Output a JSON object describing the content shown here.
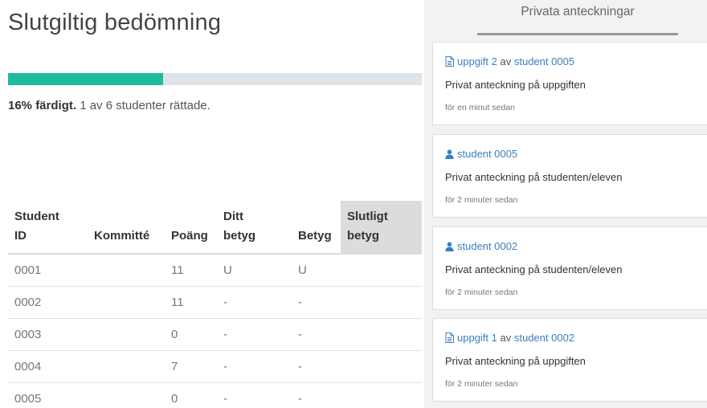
{
  "page": {
    "title": "Slutgiltig bedömning"
  },
  "progress": {
    "percent": 16,
    "fill_fraction": 0.375,
    "strong_text": "16% färdigt.",
    "detail_text": "1 av 6 studenter rättade.",
    "colors": {
      "fill": "#1fbc9c",
      "track": "#dfe4e8"
    }
  },
  "table": {
    "headers": {
      "student_id_line1": "Student",
      "student_id_line2": "ID",
      "kommitte": "Kommitté",
      "poang": "Poäng",
      "ditt_betyg_line1": "Ditt",
      "ditt_betyg_line2": "betyg",
      "betyg": "Betyg",
      "slutligt_betyg_line1": "Slutligt",
      "slutligt_betyg_line2": "betyg"
    },
    "rows": [
      {
        "id": "0001",
        "kommitte": "",
        "poang": "11",
        "ditt": "U",
        "betyg": "U",
        "slutligt": ""
      },
      {
        "id": "0002",
        "kommitte": "",
        "poang": "11",
        "ditt": "-",
        "betyg": "-",
        "slutligt": ""
      },
      {
        "id": "0003",
        "kommitte": "",
        "poang": "0",
        "ditt": "-",
        "betyg": "-",
        "slutligt": ""
      },
      {
        "id": "0004",
        "kommitte": "",
        "poang": "7",
        "ditt": "-",
        "betyg": "-",
        "slutligt": ""
      },
      {
        "id": "0005",
        "kommitte": "",
        "poang": "0",
        "ditt": "-",
        "betyg": "-",
        "slutligt": ""
      }
    ]
  },
  "sidebar": {
    "title": "Privata anteckningar",
    "notes": [
      {
        "icon": "file-icon",
        "link1": "uppgift 2",
        "sep": "av",
        "link2": "student 0005",
        "body": "Privat anteckning på uppgiften",
        "time": "för en minut sedan"
      },
      {
        "icon": "user-icon",
        "link1": "student 0005",
        "sep": "",
        "link2": "",
        "body": "Privat anteckning på studenten/eleven",
        "time": "för 2 minuter sedan"
      },
      {
        "icon": "user-icon",
        "link1": "student 0002",
        "sep": "",
        "link2": "",
        "body": "Privat anteckning på studenten/eleven",
        "time": "för 2 minuter sedan"
      },
      {
        "icon": "file-icon",
        "link1": "uppgift 1",
        "sep": "av",
        "link2": "student 0002",
        "body": "Privat anteckning på uppgiften",
        "time": "för 2 minuter sedan"
      }
    ],
    "link_color": "#3c7fc1"
  }
}
